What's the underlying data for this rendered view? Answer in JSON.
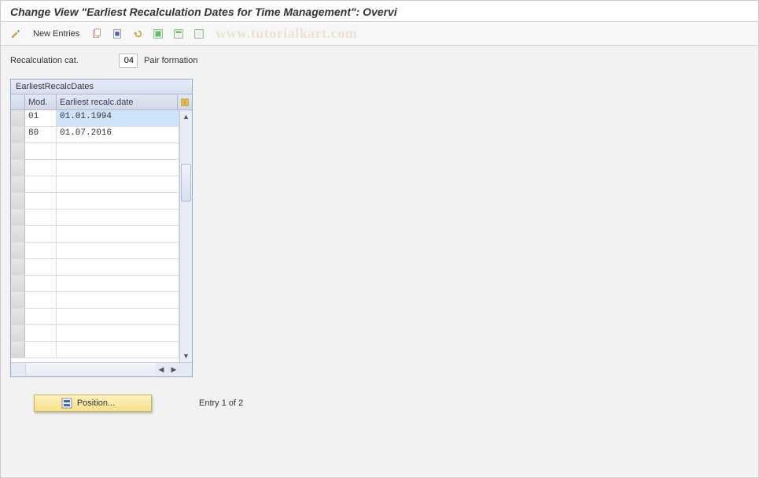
{
  "title": "Change View \"Earliest Recalculation Dates for Time Management\": Overvi",
  "toolbar": {
    "new_entries_label": "New Entries",
    "icons": {
      "pencil": "pencil-icon",
      "copy": "copy-icon",
      "delete": "delete-icon",
      "undo": "undo-icon",
      "select_all": "select-all-icon",
      "select_block": "select-block-icon",
      "deselect_all": "deselect-all-icon"
    }
  },
  "watermark": "www.tutorialkart.com",
  "field": {
    "label": "Recalculation cat.",
    "value": "04",
    "description": "Pair formation"
  },
  "table": {
    "title": "EarliestRecalcDates",
    "columns": {
      "mod": "Mod.",
      "date": "Earliest recalc.date"
    },
    "rows": [
      {
        "mod": "01",
        "date": "01.01.1994",
        "selected_date": true
      },
      {
        "mod": "80",
        "date": "01.07.2016",
        "selected_date": false
      }
    ],
    "empty_rows": 13
  },
  "position_button": {
    "label": "Position..."
  },
  "entry_status": "Entry 1 of 2"
}
